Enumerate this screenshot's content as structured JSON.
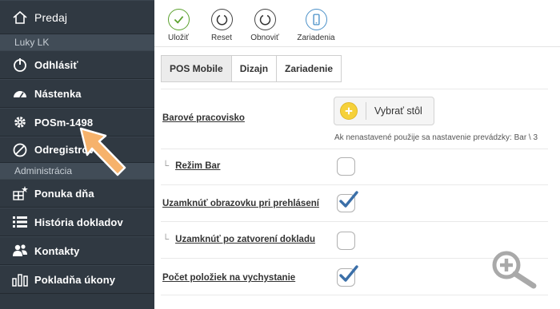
{
  "sidebar": {
    "home_label": "Predaj",
    "account_label": "Luky LK",
    "logout_label": "Odhlásiť",
    "dashboard_label": "Nástenka",
    "pos_label": "POSm-1498",
    "unregister_label": "Odregistrovať",
    "admin_label": "Administrácia",
    "daily_menu_label": "Ponuka dňa",
    "doc_history_label": "História dokladov",
    "contacts_label": "Kontakty",
    "register_ops_label": "Pokladňa úkony"
  },
  "toolbar": {
    "save_label": "Uložiť",
    "reset_label": "Reset",
    "refresh_label": "Obnoviť",
    "devices_label": "Zariadenia"
  },
  "tabs": {
    "pos_mobile": "POS Mobile",
    "design": "Dizajn",
    "device": "Zariadenie"
  },
  "settings": {
    "bar_workplace_label": "Barové pracovisko",
    "select_table_label": "Vybrať stôl",
    "hint": "Ak nenastavené použije sa nastavenie prevádzky: Bar \\ 3",
    "bar_mode_label": "Režim Bar",
    "bar_mode_checked": false,
    "lock_on_login_label": "Uzamknúť obrazovku pri prehlásení",
    "lock_on_login_checked": true,
    "lock_after_close_label": "Uzamknúť po zatvorení dokladu",
    "lock_after_close_checked": false,
    "items_count_label": "Počet položiek na vychystanie",
    "items_count_checked": true
  },
  "colors": {
    "sidebar_bg": "#303942",
    "section_bg": "#414c57",
    "save_green": "#5aa02c",
    "devices_blue": "#4a90c8",
    "check_blue": "#3b6fa8",
    "plus_yellow": "#f6d13a",
    "arrow_orange": "#f6b26b"
  }
}
